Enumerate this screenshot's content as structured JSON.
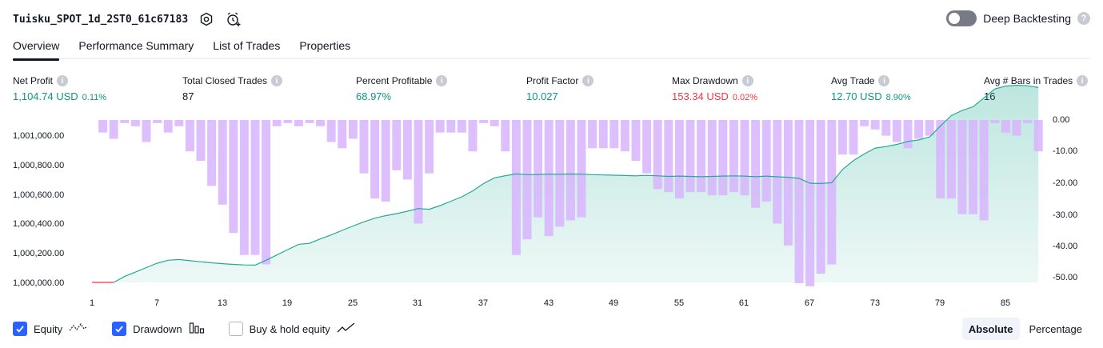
{
  "header": {
    "title": "Tuisku_SPOT_1d_2ST0_61c67183",
    "settings_icon": "gear-icon",
    "add_alert_icon": "alarm-clock-plus-icon"
  },
  "deep_backtesting": {
    "label": "Deep Backtesting",
    "enabled": false
  },
  "tabs": [
    {
      "label": "Overview",
      "active": true
    },
    {
      "label": "Performance Summary",
      "active": false
    },
    {
      "label": "List of Trades",
      "active": false
    },
    {
      "label": "Properties",
      "active": false
    }
  ],
  "metrics": [
    {
      "label": "Net Profit",
      "value": "1,104.74 USD",
      "sub": "0.11%",
      "tone": "pos"
    },
    {
      "label": "Total Closed Trades",
      "value": "87",
      "sub": "",
      "tone": "neu"
    },
    {
      "label": "Percent Profitable",
      "value": "68.97%",
      "sub": "",
      "tone": "pos"
    },
    {
      "label": "Profit Factor",
      "value": "10.027",
      "sub": "",
      "tone": "pos"
    },
    {
      "label": "Max Drawdown",
      "value": "153.34 USD",
      "sub": "0.02%",
      "tone": "neg"
    },
    {
      "label": "Avg Trade",
      "value": "12.70 USD",
      "sub": "8.90%",
      "tone": "pos"
    },
    {
      "label": "Avg # Bars in Trades",
      "value": "16",
      "sub": "",
      "tone": "neu"
    }
  ],
  "chart_data": {
    "type": "bar",
    "description_free": true,
    "x": [
      1,
      2,
      3,
      4,
      5,
      6,
      7,
      8,
      9,
      10,
      11,
      12,
      13,
      14,
      15,
      16,
      17,
      18,
      19,
      20,
      21,
      22,
      23,
      24,
      25,
      26,
      27,
      28,
      29,
      30,
      31,
      32,
      33,
      34,
      35,
      36,
      37,
      38,
      39,
      40,
      41,
      42,
      43,
      44,
      45,
      46,
      47,
      48,
      49,
      50,
      51,
      52,
      53,
      54,
      55,
      56,
      57,
      58,
      59,
      60,
      61,
      62,
      63,
      64,
      65,
      66,
      67,
      68,
      69,
      70,
      71,
      72,
      73,
      74,
      75,
      76,
      77,
      78,
      79,
      80,
      81,
      82,
      83,
      84,
      85,
      86,
      87,
      88
    ],
    "xticks": [
      "1",
      "7",
      "13",
      "19",
      "25",
      "31",
      "37",
      "43",
      "49",
      "55",
      "61",
      "67",
      "73",
      "79",
      "85"
    ],
    "equity_ylim": [
      1000000,
      1001100
    ],
    "equity_yticks": [
      "1,000,000.00",
      "1,000,200.00",
      "1,000,400.00",
      "1,000,600.00",
      "1,000,800.00",
      "1,001,000.00"
    ],
    "drawdown_ylim": [
      -52,
      0
    ],
    "drawdown_yticks": [
      "0.00",
      "-10.00",
      "-20.00",
      "-30.00",
      "-40.00",
      "-50.00"
    ],
    "series": [
      {
        "name": "Equity",
        "values": [
          0,
          0,
          0,
          40,
          70,
          100,
          130,
          150,
          155,
          147,
          140,
          133,
          127,
          122,
          118,
          117,
          150,
          186,
          222,
          258,
          265,
          295,
          322,
          352,
          382,
          410,
          435,
          452,
          466,
          482,
          500,
          495,
          520,
          550,
          580,
          620,
          670,
          708,
          723,
          735,
          730,
          731,
          733,
          732,
          734,
          733,
          730,
          728,
          726,
          724,
          722,
          725,
          722,
          718,
          720,
          718,
          716,
          718,
          720,
          722,
          720,
          716,
          720,
          715,
          712,
          705,
          672,
          670,
          675,
          765,
          825,
          870,
          910,
          920,
          935,
          955,
          965,
          985,
          1060,
          1130,
          1165,
          1190,
          1250,
          1310,
          1330,
          1335,
          1332,
          1320
        ]
      },
      {
        "name": "Drawdown",
        "values": [
          0,
          -4,
          -6,
          -1,
          -2,
          -7,
          -1,
          -4,
          -2,
          -10,
          -13,
          -21,
          -27,
          -36,
          -43,
          -43,
          -46,
          -2,
          -1,
          -2,
          -1,
          -2,
          -7,
          -9,
          -6,
          -17,
          -25,
          -26,
          -16,
          -19,
          -33,
          -17,
          -4,
          -4,
          -4,
          -10,
          -1,
          -2,
          -10,
          -43,
          -38,
          -31,
          -37,
          -34,
          -32,
          -31,
          -9,
          -9,
          -9,
          -10,
          -13,
          -17,
          -22,
          -23,
          -25,
          -23,
          -23,
          -24,
          -24,
          -23,
          -24,
          -28,
          -26,
          -33,
          -40,
          -52,
          -53,
          -49,
          -46,
          -11,
          -11,
          -2,
          -3,
          -5,
          -7,
          -9,
          -6,
          -5,
          -25,
          -25,
          -30,
          -30,
          -32,
          -1,
          -4,
          -5,
          -1,
          -10
        ]
      }
    ],
    "colors": {
      "equity_line": "#22ab94",
      "equity_neg": "#f23645",
      "drawdown_bar": "#d8b4fe"
    }
  },
  "legend": [
    {
      "label": "Equity",
      "checked": true,
      "icon": "equity-line-icon"
    },
    {
      "label": "Drawdown",
      "checked": true,
      "icon": "drawdown-bars-icon"
    },
    {
      "label": "Buy & hold equity",
      "checked": false,
      "icon": "buy-hold-line-icon"
    }
  ],
  "mode": {
    "options": [
      "Absolute",
      "Percentage"
    ],
    "selected": "Absolute"
  }
}
